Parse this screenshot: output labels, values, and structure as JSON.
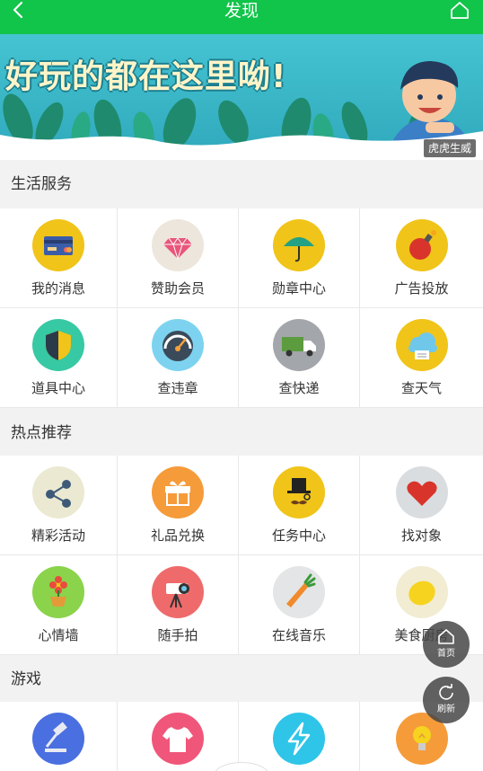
{
  "header": {
    "title": "发现"
  },
  "banner": {
    "slogan": "好玩的都在这里呦!",
    "credit": "虎虎生威"
  },
  "sections": [
    {
      "title": "生活服务",
      "items": [
        {
          "label": "我的消息",
          "icon": "credit-card-icon",
          "bg": "#f0c419"
        },
        {
          "label": "赞助会员",
          "icon": "diamond-icon",
          "bg": "#ede6dc"
        },
        {
          "label": "勋章中心",
          "icon": "umbrella-icon",
          "bg": "#f0c419"
        },
        {
          "label": "广告投放",
          "icon": "bomb-icon",
          "bg": "#f0c419"
        },
        {
          "label": "道具中心",
          "icon": "shield-icon",
          "bg": "#37c9a3"
        },
        {
          "label": "查违章",
          "icon": "speedometer-icon",
          "bg": "#7dd3ef"
        },
        {
          "label": "查快递",
          "icon": "truck-icon",
          "bg": "#a3a6ab"
        },
        {
          "label": "查天气",
          "icon": "cloud-icon",
          "bg": "#f0c419"
        }
      ]
    },
    {
      "title": "热点推荐",
      "items": [
        {
          "label": "精彩活动",
          "icon": "share-icon",
          "bg": "#ece9d2"
        },
        {
          "label": "礼品兑换",
          "icon": "gift-icon",
          "bg": "#f59b3a"
        },
        {
          "label": "任务中心",
          "icon": "gentleman-icon",
          "bg": "#f0c419"
        },
        {
          "label": "找对象",
          "icon": "heart-icon",
          "bg": "#d9dde0"
        },
        {
          "label": "心情墙",
          "icon": "flower-icon",
          "bg": "#8ad34b"
        },
        {
          "label": "随手拍",
          "icon": "camera-icon",
          "bg": "#ef6b6b"
        },
        {
          "label": "在线音乐",
          "icon": "carrot-icon",
          "bg": "#e3e5e6"
        },
        {
          "label": "美食厨房",
          "icon": "lemon-icon",
          "bg": "#f1ecd2"
        }
      ]
    },
    {
      "title": "游戏",
      "items": [
        {
          "label": "",
          "icon": "gavel-icon",
          "bg": "#4a6fe0"
        },
        {
          "label": "",
          "icon": "tshirt-icon",
          "bg": "#f0567a"
        },
        {
          "label": "",
          "icon": "lightning-icon",
          "bg": "#2ec5e8"
        },
        {
          "label": "",
          "icon": "lightbulb-icon",
          "bg": "#f59b3a"
        }
      ]
    }
  ],
  "floating": {
    "home_label": "首页",
    "refresh_label": "刷新"
  }
}
